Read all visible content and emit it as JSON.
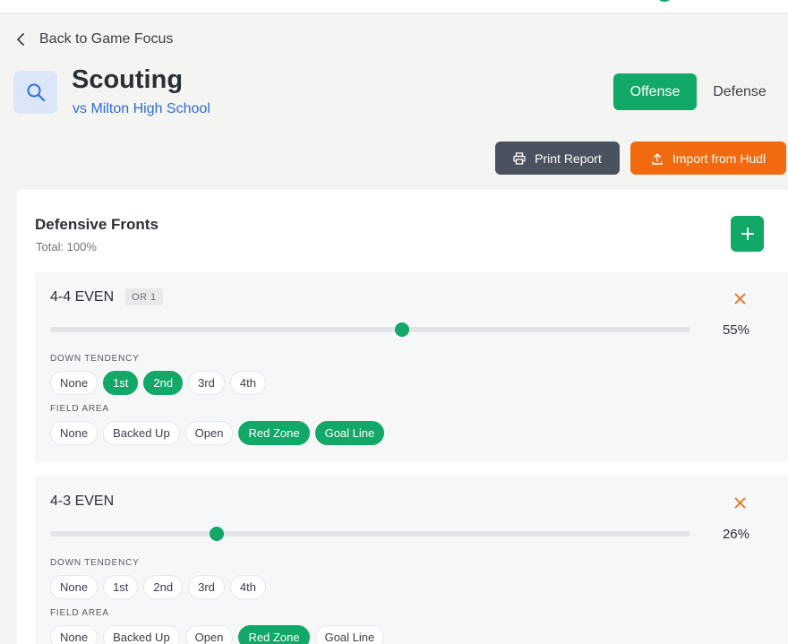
{
  "nav": {
    "back_label": "Back to Game Focus"
  },
  "header": {
    "title": "Scouting",
    "subtitle": "vs Milton High School",
    "tabs": [
      {
        "label": "Offense",
        "active": true
      },
      {
        "label": "Defense",
        "active": false
      }
    ]
  },
  "actions": {
    "print_label": "Print Report",
    "import_label": "Import from Hudl"
  },
  "panel": {
    "title": "Defensive Fronts",
    "total": "Total: 100%"
  },
  "labels": {
    "down_tendency": "DOWN TENDENCY",
    "field_area": "FIELD AREA"
  },
  "fronts": [
    {
      "name": "4-4 EVEN",
      "badge": "OR 1",
      "percent": 55,
      "percent_label": "55%",
      "downs": [
        {
          "label": "None",
          "selected": false
        },
        {
          "label": "1st",
          "selected": true
        },
        {
          "label": "2nd",
          "selected": true
        },
        {
          "label": "3rd",
          "selected": false
        },
        {
          "label": "4th",
          "selected": false
        }
      ],
      "areas": [
        {
          "label": "None",
          "selected": false
        },
        {
          "label": "Backed Up",
          "selected": false
        },
        {
          "label": "Open",
          "selected": false
        },
        {
          "label": "Red Zone",
          "selected": true
        },
        {
          "label": "Goal Line",
          "selected": true
        }
      ]
    },
    {
      "name": "4-3 EVEN",
      "badge": "",
      "percent": 26,
      "percent_label": "26%",
      "downs": [
        {
          "label": "None",
          "selected": false
        },
        {
          "label": "1st",
          "selected": false
        },
        {
          "label": "2nd",
          "selected": false
        },
        {
          "label": "3rd",
          "selected": false
        },
        {
          "label": "4th",
          "selected": false
        }
      ],
      "areas": [
        {
          "label": "None",
          "selected": false
        },
        {
          "label": "Backed Up",
          "selected": false
        },
        {
          "label": "Open",
          "selected": false
        },
        {
          "label": "Red Zone",
          "selected": true
        },
        {
          "label": "Goal Line",
          "selected": false
        }
      ]
    }
  ],
  "colors": {
    "accent": "#12a867",
    "primary_link": "#2f6fd6",
    "import": "#f26a0f",
    "print": "#4a5260",
    "remove": "#e8721c"
  },
  "icons": {
    "back": "chevron-left-icon",
    "header": "search-icon",
    "print": "printer-icon",
    "import": "upload-icon",
    "add": "plus-icon",
    "remove": "close-icon"
  }
}
